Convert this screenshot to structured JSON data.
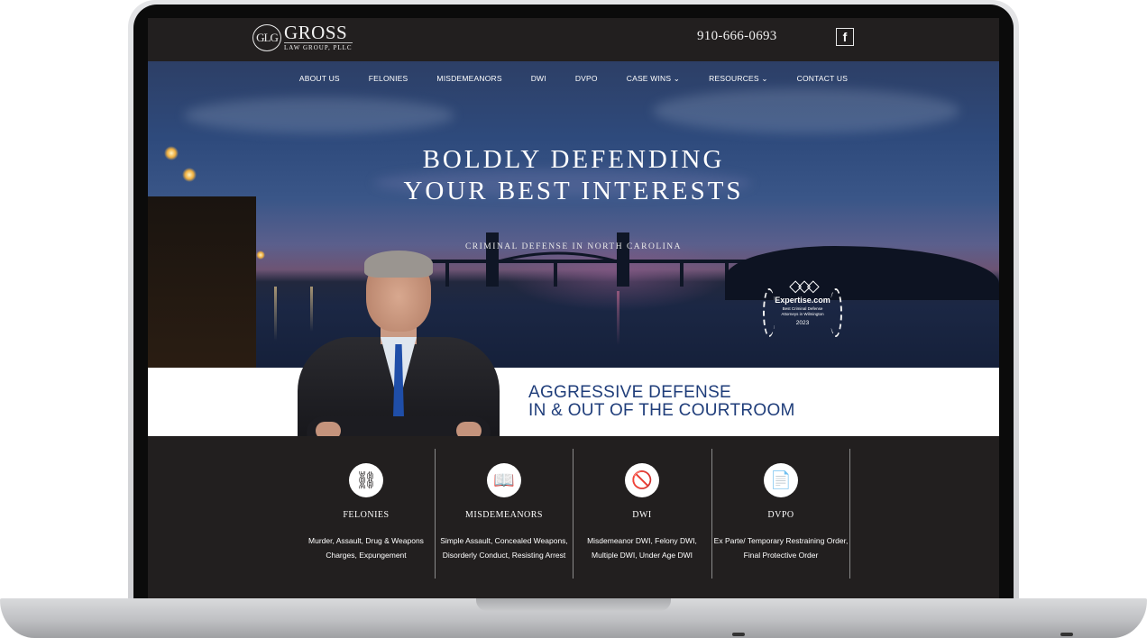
{
  "header": {
    "logo_mark": "GLG",
    "logo_name": "GROSS",
    "logo_sub": "LAW GROUP, PLLC",
    "phone": "910-666-0693",
    "social_icon": "facebook-icon",
    "social_glyph": "f"
  },
  "nav": {
    "items": [
      {
        "label": "ABOUT US"
      },
      {
        "label": "FELONIES"
      },
      {
        "label": "MISDEMEANORS"
      },
      {
        "label": "DWI"
      },
      {
        "label": "DVPO"
      },
      {
        "label": "CASE WINS ⌄"
      },
      {
        "label": "RESOURCES ⌄"
      },
      {
        "label": "CONTACT US"
      }
    ]
  },
  "hero": {
    "headline_line1": "BOLDLY DEFENDING",
    "headline_line2": "YOUR BEST INTERESTS",
    "subheadline": "CRIMINAL DEFENSE IN NORTH CAROLINA",
    "badge": {
      "name": "Expertise.com",
      "description": "Best Criminal Defense Attorneys in Wilmington",
      "year": "2023"
    }
  },
  "band": {
    "line1": "AGGRESSIVE DEFENSE",
    "line2": "IN & OUT OF THE COURTROOM",
    "color": "#1f3d7a"
  },
  "practice_areas": [
    {
      "title": "FELONIES",
      "icon": "handcuffs-icon",
      "glyph": "⛓",
      "description": "Murder, Assault, Drug & Weapons Charges, Expungement"
    },
    {
      "title": "MISDEMEANORS",
      "icon": "law-book-icon",
      "glyph": "📖",
      "description": "Simple Assault, Concealed Weapons, Disorderly Conduct, Resisting Arrest"
    },
    {
      "title": "DWI",
      "icon": "no-drinking-car-icon",
      "glyph": "🚫",
      "description": "Misdemeanor DWI, Felony DWI, Multiple DWI, Under Age DWI"
    },
    {
      "title": "DVPO",
      "icon": "legal-document-icon",
      "glyph": "📄",
      "description": "Ex Parte/ Temporary Restraining Order, Final Protective Order"
    }
  ],
  "colors": {
    "page_bg": "#221f1f",
    "accent_navy": "#1f3d7a",
    "text_light": "#ffffff"
  }
}
